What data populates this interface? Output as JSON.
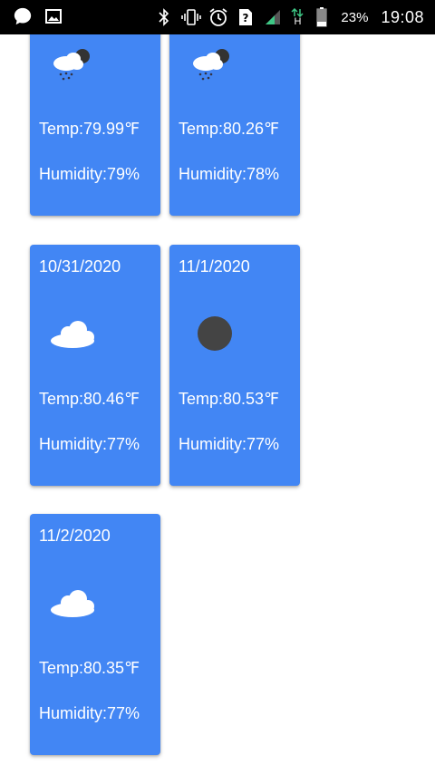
{
  "status_bar": {
    "battery_percent": "23%",
    "time": "19:08",
    "network_type": "H"
  },
  "cards": [
    {
      "date": "",
      "icon": "rain-night-icon",
      "temp": "Temp:79.99℉",
      "humidity": "Humidity:79%"
    },
    {
      "date": "",
      "icon": "rain-night-icon",
      "temp": "Temp:80.26℉",
      "humidity": "Humidity:78%"
    },
    {
      "date": "10/31/2020",
      "icon": "cloud-icon",
      "temp": "Temp:80.46℉",
      "humidity": "Humidity:77%"
    },
    {
      "date": "11/1/2020",
      "icon": "moon-icon",
      "temp": "Temp:80.53℉",
      "humidity": "Humidity:77%"
    },
    {
      "date": "11/2/2020",
      "icon": "cloud-icon",
      "temp": "Temp:80.35℉",
      "humidity": "Humidity:77%"
    }
  ],
  "colors": {
    "card_bg": "#4286f4",
    "text": "#ffffff"
  }
}
